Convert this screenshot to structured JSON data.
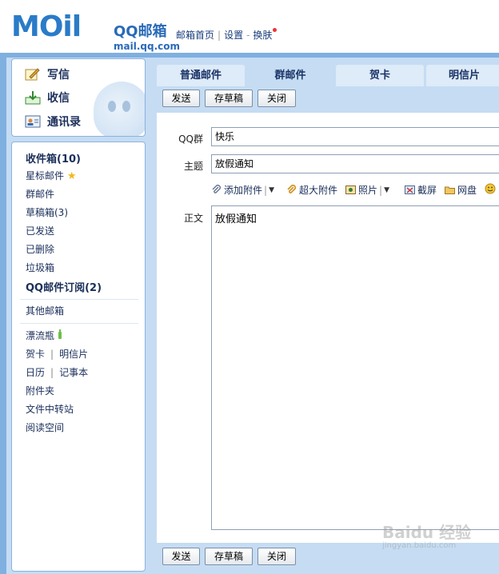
{
  "header": {
    "logo_text": "MOil",
    "brand": "QQ邮箱",
    "domain": "mail.qq.com",
    "links": [
      "邮箱首页",
      "设置",
      "换肤"
    ]
  },
  "sidebar": {
    "actions": [
      {
        "label": "写信",
        "icon": "pencil-note-icon"
      },
      {
        "label": "收信",
        "icon": "inbox-arrow-icon"
      },
      {
        "label": "通讯录",
        "icon": "contact-card-icon"
      }
    ],
    "folders": {
      "inbox": "收件箱(10)",
      "starred": "星标邮件",
      "group": "群邮件",
      "drafts": "草稿箱(3)",
      "sent": "已发送",
      "deleted": "已删除",
      "trash": "垃圾箱",
      "subscription": "QQ邮件订阅(2)",
      "other": "其他邮箱",
      "bottle": "漂流瓶",
      "card": "贺卡",
      "postcard": "明信片",
      "calendar": "日历",
      "notebook": "记事本",
      "attachments": "附件夹",
      "transfer": "文件中转站",
      "reading": "阅读空间"
    }
  },
  "tabs": [
    "普通邮件",
    "群邮件",
    "贺卡",
    "明信片"
  ],
  "active_tab": 1,
  "toolbar": {
    "send": "发送",
    "save_draft": "存草稿",
    "close": "关闭"
  },
  "compose": {
    "group_label": "QQ群",
    "group_value": "快乐",
    "subject_label": "主题",
    "subject_value": "放假通知",
    "body_label": "正文",
    "body_value": "放假通知",
    "attachments": {
      "add": "添加附件",
      "large": "超大附件",
      "photo": "照片",
      "screenshot": "截屏",
      "disk": "网盘"
    }
  },
  "watermark": {
    "main": "Baidu 经验",
    "sub": "jingyan.baidu.com"
  },
  "colors": {
    "frame_blue": "#7fb0e0",
    "panel_blue": "#c5dcf3",
    "tab_inactive": "#deebf8",
    "logo_blue": "#2a7bc8",
    "text_navy": "#1a2f5a"
  }
}
